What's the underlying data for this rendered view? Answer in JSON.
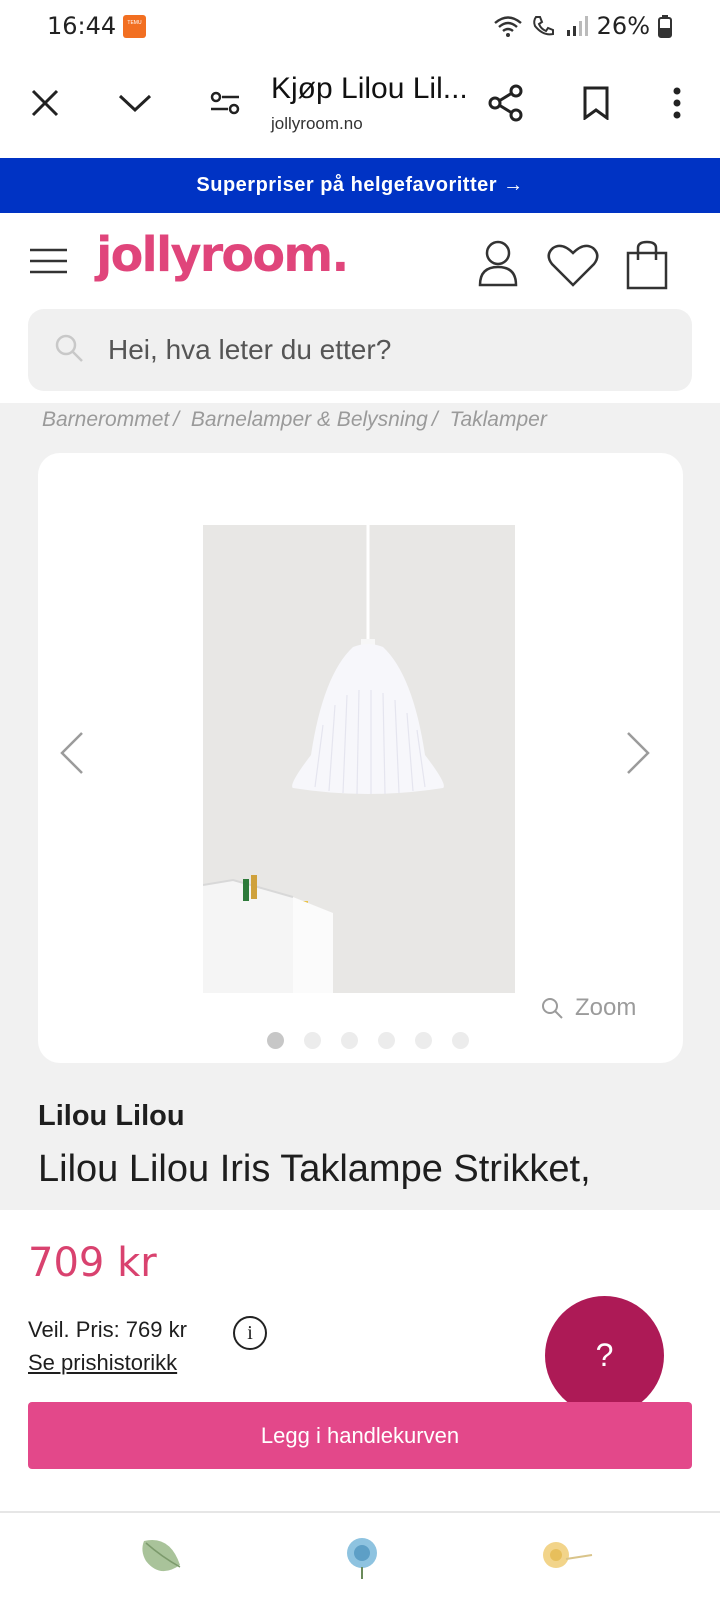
{
  "status_bar": {
    "time": "16:44",
    "notification_badge": "TEMU",
    "battery": "26%"
  },
  "browser": {
    "title": "Kjøp Lilou Lil...",
    "url": "jollyroom.no",
    "icons": [
      "close-icon",
      "chevron-down-icon",
      "site-settings-icon",
      "share-icon",
      "bookmark-icon",
      "more-vert-icon"
    ]
  },
  "promo": {
    "text": "Superpriser på helgefavoritter →"
  },
  "header": {
    "logo": "jollyroom.",
    "icons": [
      "menu-icon",
      "account-icon",
      "heart-icon",
      "shopping-bag-icon"
    ]
  },
  "search": {
    "placeholder": "Hei, hva leter du etter?"
  },
  "breadcrumb": {
    "items": [
      "Barnerommet",
      "Barnelamper & Belysning",
      "Taklamper"
    ]
  },
  "gallery": {
    "zoom_label": "Zoom",
    "dot_count": 6,
    "active_index": 0
  },
  "product": {
    "brand": "Lilou Lilou",
    "title": "Lilou Lilou Iris Taklampe Strikket,",
    "price": "709 kr",
    "rrp": "Veil. Pris: 769 kr",
    "info_symbol": "i",
    "price_history_link": "Se prishistorikk",
    "add_to_cart": "Legg i handlekurven",
    "help_symbol": "?"
  },
  "colors": {
    "promo_bg": "#0033c4",
    "brand_pink": "#e0457b",
    "price": "#d9426f",
    "cart_button": "#e3488a",
    "help_button": "#ad1a56"
  }
}
